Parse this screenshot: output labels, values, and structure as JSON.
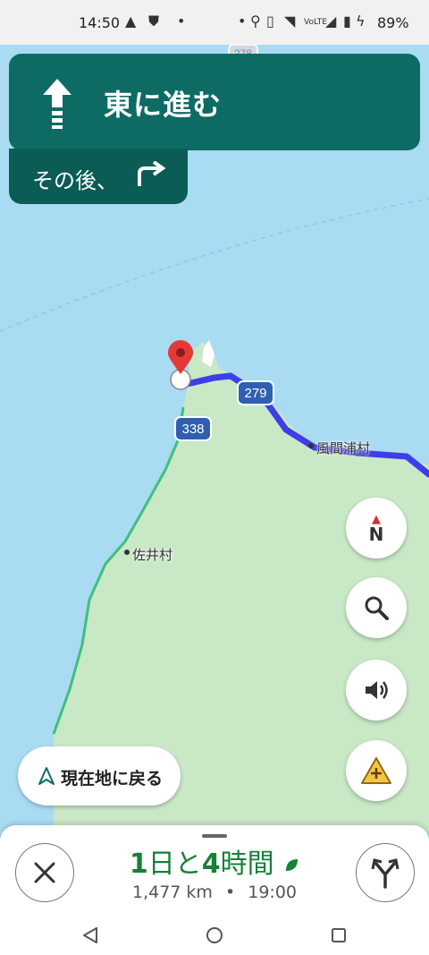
{
  "status": {
    "time": "14:50",
    "battery": "89%",
    "icons_left": [
      "navigation-arrow-icon",
      "shield-icon",
      "dot-icon"
    ],
    "icons_right": [
      "dot-icon",
      "location-icon",
      "vibrate-icon",
      "wifi-icon",
      "volte-icon",
      "signal-icon",
      "battery-icon",
      "charging-icon"
    ]
  },
  "navigation": {
    "instruction": "東に進む",
    "then_label": "その後、",
    "direction_icon": "straight-arrow-icon",
    "then_icon": "turn-right-icon"
  },
  "map": {
    "labels": {
      "kazamaura": "風間浦村",
      "sai": "佐井村"
    },
    "route_shields": [
      "279",
      "338",
      "278"
    ]
  },
  "controls": {
    "compass_label": "N",
    "recenter_label": "現在地に戻る"
  },
  "trip": {
    "duration_prefix": "1",
    "duration_day": "日と",
    "duration_hours": "4",
    "duration_suffix": "時間",
    "distance": "1,477 km",
    "separator": "•",
    "arrival": "19:00"
  },
  "colors": {
    "banner": "#0d6b63",
    "route": "#3e3ee8",
    "eta": "#188038",
    "land": "#c9e8c6",
    "water": "#a9dbf3"
  }
}
